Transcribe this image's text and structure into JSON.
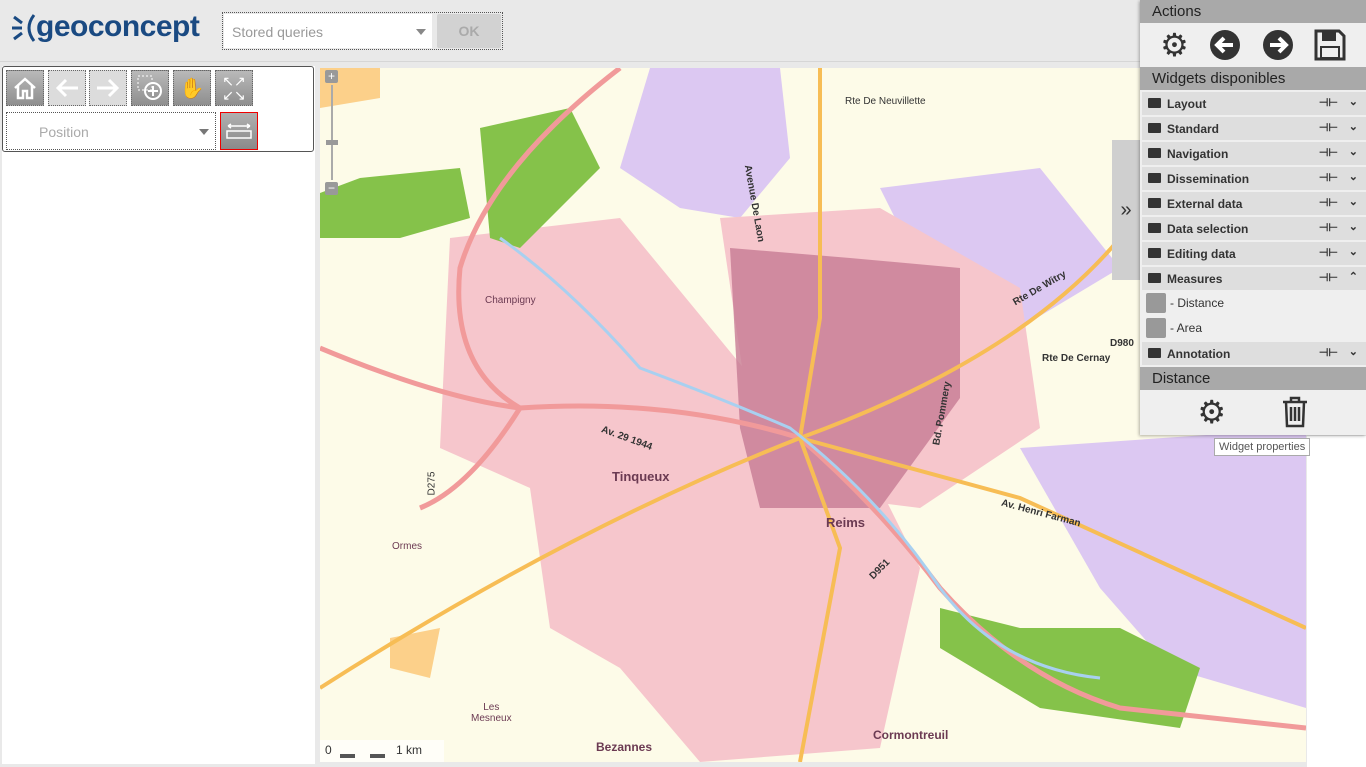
{
  "header": {
    "logo_text": "Geoconcept",
    "stored_queries_placeholder": "Stored queries",
    "ok_label": "OK"
  },
  "toolbar": {
    "position_placeholder": "Position",
    "buttons": [
      "home-icon",
      "back-arrow-icon",
      "forward-arrow-icon",
      "zoom-box-icon",
      "pan-hand-icon",
      "full-extent-icon",
      "ruler-icon"
    ]
  },
  "map": {
    "labels": {
      "tinqueux": "Tinqueux",
      "reims": "Reims",
      "champigny": "Champigny",
      "ormes": "Ormes",
      "bezannes": "Bezannes",
      "cormontreuil": "Cormontreuil",
      "les_mesneux": "Les\nMesneux",
      "d980": "D980",
      "d951": "D951",
      "d275": "D275",
      "avenue_laon": "Avenue De Laon",
      "rte_witry": "Rte De Witry",
      "av_1944": "Av. 29 1944",
      "av_farman": "Av. Henri Farman",
      "bd_pommery": "Bd. Pommery",
      "rte_cernay": "Rte De Cernay",
      "rte_neuvillette": "Rte De Neuvillette"
    },
    "scale": {
      "zero": "0",
      "distance": "1 km"
    },
    "zoom_in": "+",
    "zoom_out": "−"
  },
  "panel": {
    "actions_title": "Actions",
    "action_icons": [
      "settings-gears-icon",
      "undo-circle-icon",
      "redo-circle-icon",
      "save-floppy-icon"
    ],
    "widgets_title": "Widgets disponibles",
    "groups": [
      {
        "label": "Layout",
        "expanded": false
      },
      {
        "label": "Standard",
        "expanded": false
      },
      {
        "label": "Navigation",
        "expanded": false
      },
      {
        "label": "Dissemination",
        "expanded": false
      },
      {
        "label": "External data",
        "expanded": false
      },
      {
        "label": "Data selection",
        "expanded": false
      },
      {
        "label": "Editing data",
        "expanded": false
      },
      {
        "label": "Measures",
        "expanded": true
      }
    ],
    "measures_items": [
      {
        "label": "- Distance",
        "icon": "ruler-icon"
      },
      {
        "label": "- Area",
        "icon": "area-icon"
      }
    ],
    "group_after": {
      "label": "Annotation",
      "expanded": false
    },
    "distance_title": "Distance",
    "pin_glyph": "⊣⊢",
    "collapse_glyph": "»",
    "tooltip": "Widget properties"
  },
  "colors": {
    "accent": "#1a4a82",
    "panel_header": "#a9a9a9",
    "urban": "#f6c6cc",
    "dense": "#c77b93",
    "forest": "#85c24a",
    "industrial": "#dcc8f2",
    "road": "#f7bd55",
    "highway": "#f19a9a"
  }
}
